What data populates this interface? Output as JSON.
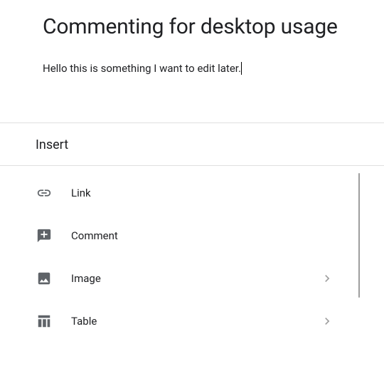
{
  "document": {
    "title": "Commenting for desktop usage",
    "body": "Hello this is something I want to edit later."
  },
  "panel": {
    "header": "Insert",
    "items": [
      {
        "label": "Link",
        "icon": "link-icon",
        "has_submenu": false
      },
      {
        "label": "Comment",
        "icon": "comment-icon",
        "has_submenu": false
      },
      {
        "label": "Image",
        "icon": "image-icon",
        "has_submenu": true
      },
      {
        "label": "Table",
        "icon": "table-icon",
        "has_submenu": true
      }
    ]
  }
}
